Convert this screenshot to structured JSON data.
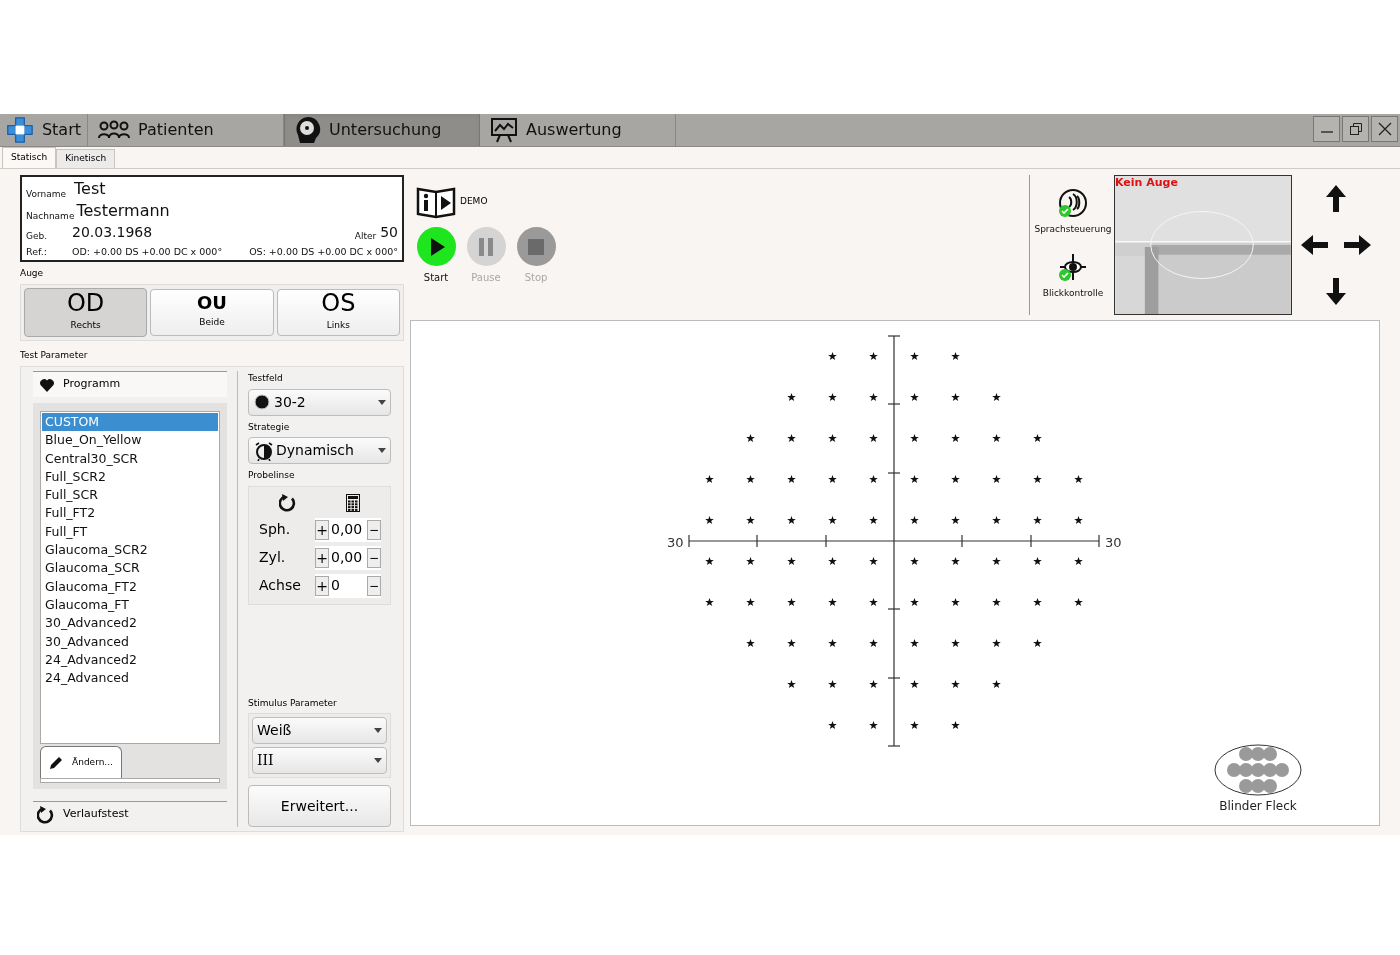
{
  "nav_tabs": [
    {
      "label": "Start",
      "kind": "logo",
      "selected": false
    },
    {
      "label": "Patienten",
      "kind": "people",
      "selected": false
    },
    {
      "label": "Untersuchung",
      "kind": "eye",
      "selected": true
    },
    {
      "label": "Auswertung",
      "kind": "chart",
      "selected": false
    }
  ],
  "sub_tabs": [
    {
      "label": "Statisch",
      "selected": true
    },
    {
      "label": "Kinetisch",
      "selected": false
    }
  ],
  "patient": {
    "first_name_label": "Vorname",
    "first_name": "Test",
    "last_name_label": "Nachname",
    "last_name": "Testermann",
    "birth_label": "Geb.",
    "birth": "20.03.1968",
    "age_label": "Alter",
    "age": "50",
    "ref_label": "Ref.:",
    "ref_od": "OD: +0.00 DS +0.00 DC x 000°",
    "ref_os": "OS: +0.00 DS +0.00 DC x 000°"
  },
  "eye": {
    "label": "Auge",
    "options": [
      {
        "code": "OD",
        "name": "Rechts",
        "selected": true
      },
      {
        "code": "OU",
        "name": "Beide",
        "selected": false
      },
      {
        "code": "OS",
        "name": "Links",
        "selected": false
      }
    ]
  },
  "test_parameter": {
    "label": "Test Parameter",
    "program_tab": "Programm",
    "history_tab": "Verlaufstest",
    "edit_tab": "Ändern...",
    "programs": [
      {
        "name": "CUSTOM",
        "selected": true
      },
      {
        "name": "Blue_On_Yellow",
        "selected": false
      },
      {
        "name": "Central30_SCR",
        "selected": false
      },
      {
        "name": "Full_SCR2",
        "selected": false
      },
      {
        "name": "Full_SCR",
        "selected": false
      },
      {
        "name": "Full_FT2",
        "selected": false
      },
      {
        "name": "Full_FT",
        "selected": false
      },
      {
        "name": "Glaucoma_SCR2",
        "selected": false
      },
      {
        "name": "Glaucoma_SCR",
        "selected": false
      },
      {
        "name": "Glaucoma_FT2",
        "selected": false
      },
      {
        "name": "Glaucoma_FT",
        "selected": false
      },
      {
        "name": "30_Advanced2",
        "selected": false
      },
      {
        "name": "30_Advanced",
        "selected": false
      },
      {
        "name": "24_Advanced2",
        "selected": false
      },
      {
        "name": "24_Advanced",
        "selected": false
      }
    ]
  },
  "testfeld": {
    "label": "Testfeld",
    "value": "30-2"
  },
  "strategie": {
    "label": "Strategie",
    "value": "Dynamisch"
  },
  "probelinse": {
    "label": "Probelinse",
    "rows": [
      {
        "label": "Sph.",
        "plus": "+",
        "value": "0,00",
        "minus": "−"
      },
      {
        "label": "Zyl.",
        "plus": "+",
        "value": "0,00",
        "minus": "−"
      },
      {
        "label": "Achse",
        "plus": "+",
        "value": "0",
        "minus": "−"
      }
    ]
  },
  "stimulus": {
    "label": "Stimulus Parameter",
    "light": "Weiß",
    "size": "III"
  },
  "advanced_button": "Erweitert...",
  "demo_label": "DEMO",
  "controls": [
    {
      "kind": "play",
      "label": "Start",
      "disabled": false
    },
    {
      "kind": "pause",
      "label": "Pause",
      "disabled": true
    },
    {
      "kind": "stop",
      "label": "Stop",
      "disabled": true
    }
  ],
  "status": [
    {
      "kind": "voice",
      "label": "Sprachsteuerung",
      "on": true
    },
    {
      "kind": "gaze",
      "label": "Blickkontrolle",
      "on": true
    }
  ],
  "camera": {
    "overlay": "Kein Auge"
  },
  "chart": {
    "left_label": "30",
    "right_label": "30"
  },
  "blind_spot": {
    "label": "Blinder Fleck"
  }
}
